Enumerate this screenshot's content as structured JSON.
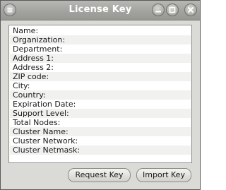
{
  "window": {
    "title": "License Key"
  },
  "titlebar_icons": {
    "menu": "menu-icon",
    "minimize": "minimize-icon",
    "maximize": "maximize-icon",
    "close": "close-icon"
  },
  "fields": [
    {
      "label": "Name:"
    },
    {
      "label": "Organization:"
    },
    {
      "label": "Department:"
    },
    {
      "label": "Address 1:"
    },
    {
      "label": "Address 2:"
    },
    {
      "label": "ZIP code:"
    },
    {
      "label": "City:"
    },
    {
      "label": "Country:"
    },
    {
      "label": "Expiration Date:"
    },
    {
      "label": "Support Level:"
    },
    {
      "label": "Total Nodes:"
    },
    {
      "label": "Cluster Name:"
    },
    {
      "label": "Cluster Network:"
    },
    {
      "label": "Cluster Netmask:"
    }
  ],
  "buttons": {
    "request_label": "Request Key",
    "import_label": "Import Key"
  }
}
